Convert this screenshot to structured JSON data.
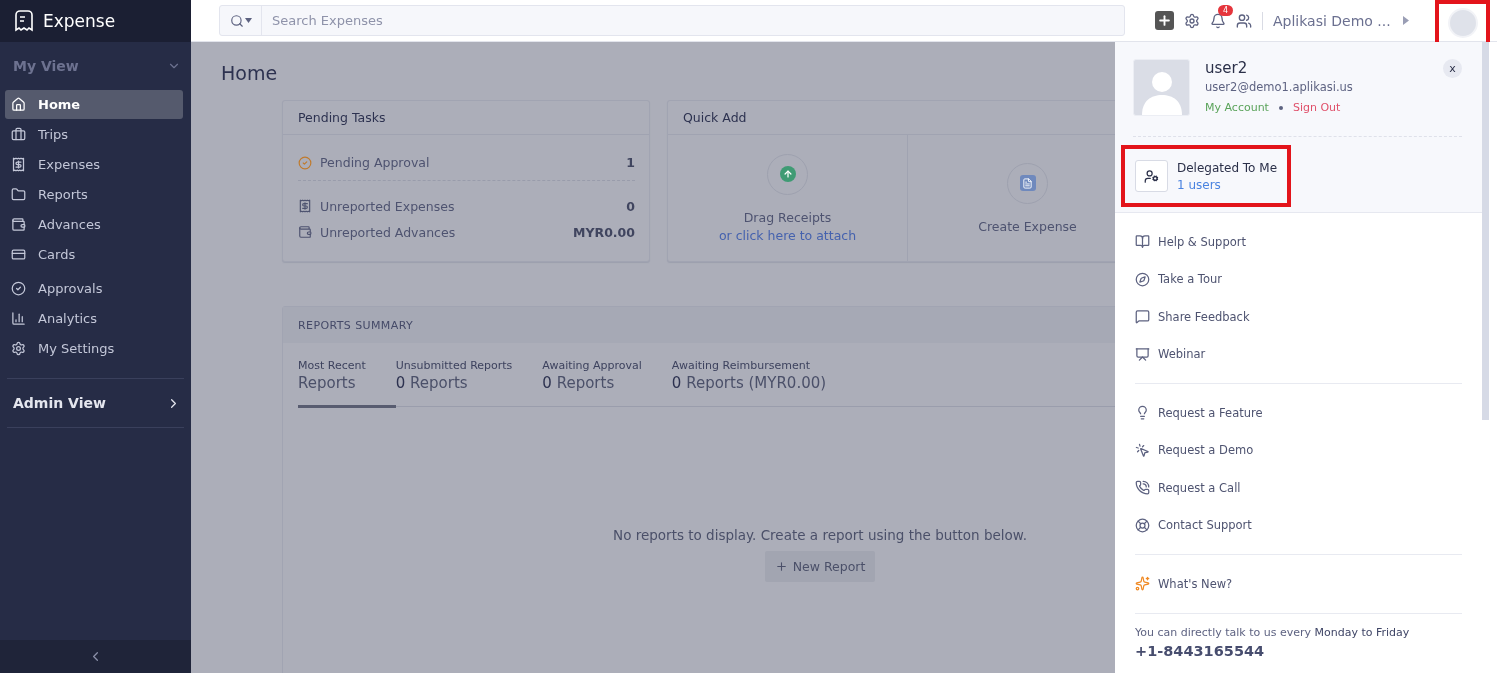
{
  "app": {
    "name": "Expense"
  },
  "search": {
    "placeholder": "Search Expenses"
  },
  "topbar": {
    "notification_count": "4",
    "org": "Aplikasi Demo ...",
    "avatar_highlighted": true
  },
  "sidebar": {
    "sections": [
      {
        "title": "My View",
        "expanded": true,
        "items": [
          {
            "label": "Home",
            "selected": true
          },
          {
            "label": "Trips",
            "selected": false
          },
          {
            "label": "Expenses",
            "selected": false
          },
          {
            "label": "Reports",
            "selected": false
          },
          {
            "label": "Advances",
            "selected": false
          },
          {
            "label": "Cards",
            "selected": false
          },
          {
            "label": "Approvals",
            "selected": false
          },
          {
            "label": "Analytics",
            "selected": false
          },
          {
            "label": "My Settings",
            "selected": false
          }
        ]
      },
      {
        "title": "Admin View",
        "expanded": false
      }
    ]
  },
  "page": {
    "title": "Home"
  },
  "pending_tasks": {
    "title": "Pending Tasks",
    "rows": [
      {
        "label": "Pending Approval",
        "value": "1"
      },
      {
        "label": "Unreported Expenses",
        "value": "0"
      },
      {
        "label": "Unreported Advances",
        "value": "MYR0.00"
      }
    ]
  },
  "quick_add": {
    "title": "Quick Add",
    "items": [
      {
        "label": "Drag Receipts",
        "link": "or click here to attach"
      },
      {
        "label": "Create Expense"
      }
    ]
  },
  "reports_summary": {
    "title": "REPORTS SUMMARY",
    "tabs": [
      {
        "caption": "Most Recent",
        "label": "Reports",
        "selected": true
      },
      {
        "caption": "Unsubmitted Reports",
        "count": "0",
        "label": "Reports",
        "selected": false
      },
      {
        "caption": "Awaiting Approval",
        "count": "0",
        "label": "Reports",
        "selected": false
      },
      {
        "caption": "Awaiting Reimbursement",
        "count": "0",
        "label": "Reports (MYR0.00)",
        "selected": false
      }
    ],
    "empty_text": "No reports to display. Create a report using the button below.",
    "button": "New Report"
  },
  "profile": {
    "name": "user2",
    "email": "user2@demo1.aplikasi.us",
    "my_account": "My Account",
    "sign_out": "Sign Out",
    "close": "x",
    "delegated": {
      "title": "Delegated To Me",
      "count": "1 users",
      "highlighted": true
    },
    "menu_groups": [
      [
        "Help & Support",
        "Take a Tour",
        "Share Feedback",
        "Webinar"
      ],
      [
        "Request a Feature",
        "Request a Demo",
        "Request a Call",
        "Contact Support"
      ],
      [
        "What's New?"
      ]
    ],
    "footer": {
      "text": "You can directly talk to us every **Monday to Friday**",
      "phone": "+1-8443165544"
    }
  }
}
